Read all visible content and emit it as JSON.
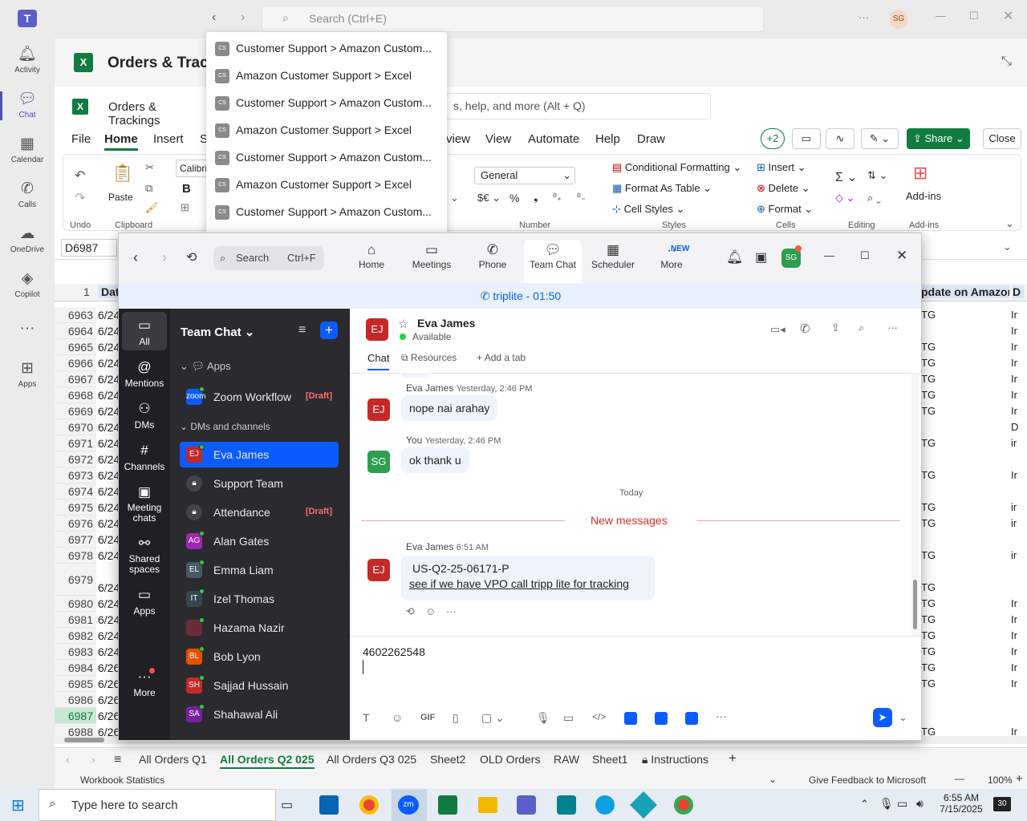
{
  "teams": {
    "rail": [
      {
        "label": "Activity",
        "icon": "bell-icon"
      },
      {
        "label": "Chat",
        "icon": "chat-icon"
      },
      {
        "label": "Calendar",
        "icon": "calendar-icon"
      },
      {
        "label": "Calls",
        "icon": "phone-icon"
      },
      {
        "label": "OneDrive",
        "icon": "cloud-icon"
      },
      {
        "label": "Copilot",
        "icon": "copilot-icon"
      },
      {
        "label": "Apps",
        "icon": "apps-icon"
      }
    ],
    "search_placeholder": "Search (Ctrl+E)",
    "avatar_initials": "SG",
    "dropdown": [
      "Customer Support > Amazon Custom...",
      "Amazon Customer Support > Excel",
      "Customer Support > Amazon Custom...",
      "Amazon Customer Support > Excel",
      "Customer Support > Amazon Custom...",
      "Amazon Customer Support > Excel",
      "Customer Support > Amazon Custom..."
    ],
    "dropdown_icon_text": "CS"
  },
  "excel": {
    "title": "Orders & Track",
    "file_title": "Orders & Trackings",
    "tell_me": "s, help, and more (Alt + Q)",
    "menu": [
      "File",
      "Home",
      "Insert",
      "S",
      "view",
      "View",
      "Automate",
      "Help",
      "Draw"
    ],
    "plus_count": "+2",
    "share_label": "Share",
    "close_label": "Close",
    "font_name": "Calibri",
    "undo_label": "Undo",
    "clipboard_label": "Clipboard",
    "paste_label": "Paste",
    "number_format": "General",
    "number_label": "Number",
    "conditional": "Conditional Formatting",
    "format_table": "Format As Table",
    "cell_styles": "Cell Styles",
    "styles_label": "Styles",
    "insert": "Insert",
    "delete": "Delete",
    "format": "Format",
    "cells_label": "Cells",
    "editing_label": "Editing",
    "addins": "Add-ins",
    "addins_label": "Add-ins",
    "name_box": "D6987",
    "col_header_date": "Date",
    "col_header_amazon": "pdate on Amazon",
    "col_header_d": "D",
    "row1": "1",
    "rows": [
      {
        "n": "6963",
        "d": "6/24",
        "r": "TG",
        "s": "Ir"
      },
      {
        "n": "6964",
        "d": "6/24",
        "r": "",
        "s": "Ir"
      },
      {
        "n": "6965",
        "d": "6/24",
        "r": "TG",
        "s": "Ir"
      },
      {
        "n": "6966",
        "d": "6/24",
        "r": "TG",
        "s": "Ir"
      },
      {
        "n": "6967",
        "d": "6/24",
        "r": "TG",
        "s": "Ir"
      },
      {
        "n": "6968",
        "d": "6/24",
        "r": "TG",
        "s": "Ir"
      },
      {
        "n": "6969",
        "d": "6/24",
        "r": "TG",
        "s": "Ir"
      },
      {
        "n": "6970",
        "d": "6/24",
        "r": "",
        "s": "D"
      },
      {
        "n": "6971",
        "d": "6/24",
        "r": "TG",
        "s": "ir"
      },
      {
        "n": "6972",
        "d": "6/24",
        "r": "",
        "s": ""
      },
      {
        "n": "6973",
        "d": "6/24",
        "r": "TG",
        "s": "Ir"
      },
      {
        "n": "6974",
        "d": "6/24",
        "r": "",
        "s": ""
      },
      {
        "n": "6975",
        "d": "6/24",
        "r": "TG",
        "s": "ir"
      },
      {
        "n": "6976",
        "d": "6/24",
        "r": "TG",
        "s": "ir"
      },
      {
        "n": "6977",
        "d": "6/24",
        "r": "",
        "s": ""
      },
      {
        "n": "6978",
        "d": "6/24",
        "r": "TG",
        "s": "ir"
      },
      {
        "n": "6979",
        "d": "6/24",
        "r": "TG",
        "s": ""
      },
      {
        "n": "6980",
        "d": "6/24",
        "r": "TG",
        "s": "Ir"
      },
      {
        "n": "6981",
        "d": "6/24",
        "r": "TG",
        "s": "Ir"
      },
      {
        "n": "6982",
        "d": "6/24",
        "r": "TG",
        "s": "Ir"
      },
      {
        "n": "6983",
        "d": "6/24",
        "r": "TG",
        "s": "Ir"
      },
      {
        "n": "6984",
        "d": "6/26",
        "r": "TG",
        "s": "Ir"
      },
      {
        "n": "6985",
        "d": "6/26",
        "r": "TG",
        "s": "Ir"
      },
      {
        "n": "6986",
        "d": "6/26",
        "r": "",
        "s": ""
      },
      {
        "n": "6987",
        "d": "6/26",
        "r": "",
        "s": ""
      },
      {
        "n": "6988",
        "d": "6/26",
        "r": "TG",
        "s": "Ir"
      }
    ],
    "sheets": [
      "All Orders Q1",
      "All Orders Q2 025",
      "All Orders Q3 025",
      "Sheet2",
      "OLD Orders",
      "RAW",
      "Sheet1",
      "Instructions"
    ],
    "status_left": "Workbook Statistics",
    "feedback": "Give Feedback to Microsoft",
    "zoom": "100%"
  },
  "zoom": {
    "search": "Search",
    "search_shortcut": "Ctrl+F",
    "tabs": [
      {
        "label": "Home",
        "icon": "home-icon"
      },
      {
        "label": "Meetings",
        "icon": "video-icon"
      },
      {
        "label": "Phone",
        "icon": "phone-icon"
      },
      {
        "label": "Team Chat",
        "icon": "team-chat-icon"
      },
      {
        "label": "Scheduler",
        "icon": "scheduler-icon"
      },
      {
        "label": "More",
        "icon": "more-icon"
      }
    ],
    "new_badge": "NEW",
    "avatar_initials": "SG",
    "banner": "triplite - 01:50",
    "nav": [
      {
        "label": "All",
        "icon": "all-icon"
      },
      {
        "label": "Mentions",
        "icon": "mention-icon"
      },
      {
        "label": "DMs",
        "icon": "dms-icon"
      },
      {
        "label": "Channels",
        "icon": "channels-icon"
      },
      {
        "label": "Meeting chats",
        "icon": "meeting-chats-icon"
      },
      {
        "label": "Shared spaces",
        "icon": "shared-spaces-icon"
      },
      {
        "label": "Apps",
        "icon": "apps-icon"
      },
      {
        "label": "More",
        "icon": "more-icon"
      }
    ],
    "list_title": "Team Chat",
    "section_apps": "Apps",
    "section_dms": "DMs and channels",
    "draft": "[Draft]",
    "items": [
      {
        "name": "Zoom Workflow",
        "initials": "zoom",
        "color": "#0b5cff",
        "draft": true
      },
      {
        "name": "Eva James",
        "initials": "EJ",
        "color": "#c62828",
        "draft": false,
        "selected": true
      },
      {
        "name": "Support Team",
        "initials": "",
        "color": "#555",
        "draft": false,
        "lock": true
      },
      {
        "name": "Attendance",
        "initials": "",
        "color": "#555",
        "draft": true,
        "lock": true
      },
      {
        "name": "Alan Gates",
        "initials": "AG",
        "color": "#9c27b0",
        "draft": false
      },
      {
        "name": "Emma Liam",
        "initials": "EL",
        "color": "#455a64",
        "draft": false
      },
      {
        "name": "Izel Thomas",
        "initials": "IT",
        "color": "#37474f",
        "draft": false
      },
      {
        "name": "Hazama Nazir",
        "initials": "",
        "color": "#6d2b3a",
        "draft": false
      },
      {
        "name": "Bob Lyon",
        "initials": "BL",
        "color": "#e65100",
        "draft": false
      },
      {
        "name": "Sajjad Hussain",
        "initials": "SH",
        "color": "#c62828",
        "draft": false
      },
      {
        "name": "Shahawal Ali",
        "initials": "SA",
        "color": "#7b1fa2",
        "draft": false
      }
    ],
    "contact_name": "Eva James",
    "contact_initials": "EJ",
    "contact_status": "Available",
    "chat_tabs": {
      "chat": "Chat",
      "resources": "Resources",
      "add": "Add a tab"
    },
    "messages": [
      {
        "sender": "Eva James",
        "time": "Yesterday, 2:46 PM",
        "text": "nope nai arahay",
        "initials": "EJ"
      },
      {
        "sender": "You",
        "time": "Yesterday, 2:46 PM",
        "text": "ok thank u",
        "initials": "SG"
      }
    ],
    "today": "Today",
    "new_messages": "New messages",
    "last_msg": {
      "sender": "Eva James",
      "time": "6:51 AM",
      "line1": "US-Q2-25-06171-P",
      "line2": "see if we have VPO call tripp lite for tracking",
      "initials": "EJ"
    },
    "compose_text": "4602262548",
    "gif": "GIF"
  },
  "taskbar": {
    "search": "Type here to search",
    "time": "6:55 AM",
    "date": "7/15/2025",
    "notif_count": "30"
  },
  "colors": {
    "teams_accent": "#4f52b2",
    "excel_green": "#107c41",
    "zoom_blue": "#0b5cff"
  }
}
